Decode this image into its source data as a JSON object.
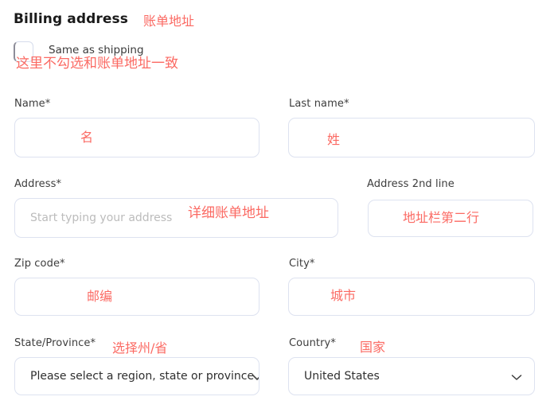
{
  "section": {
    "title": "Billing address",
    "title_annotation": "账单地址"
  },
  "checkbox": {
    "label": "Same as shipping",
    "checked": false,
    "annotation": "这里不勾选和账单地址一致"
  },
  "colors": {
    "annotation": "#fb6a63",
    "field_border": "#dde2f0",
    "placeholder": "#bcbcbc",
    "label": "#3d3d3d",
    "title": "#1a1a1a"
  },
  "fields": [
    {
      "name": "first-name",
      "label": "Name*",
      "value": "",
      "placeholder": "",
      "type": "text",
      "annotation": "名"
    },
    {
      "name": "last-name",
      "label": "Last name*",
      "value": "",
      "placeholder": "",
      "type": "text",
      "annotation": "姓"
    },
    {
      "name": "address",
      "label": "Address*",
      "value": "",
      "placeholder": "Start typing your address",
      "type": "text",
      "annotation": "详细账单地址"
    },
    {
      "name": "address-2nd-line",
      "label": "Address 2nd line",
      "value": "",
      "placeholder": "",
      "type": "text",
      "annotation": "地址栏第二行"
    },
    {
      "name": "zip-code",
      "label": "Zip code*",
      "value": "",
      "placeholder": "",
      "type": "text",
      "annotation": "邮编"
    },
    {
      "name": "city",
      "label": "City*",
      "value": "",
      "placeholder": "",
      "type": "text",
      "annotation": "城市"
    },
    {
      "name": "state-province",
      "label": "State/Province*",
      "value": "Please select a region, state or province",
      "placeholder": "",
      "type": "select",
      "annotation": "选择州/省"
    },
    {
      "name": "country",
      "label": "Country*",
      "value": "United States",
      "placeholder": "",
      "type": "select",
      "annotation": "国家"
    }
  ],
  "icons": {
    "chevron_down": "chevron-down-icon",
    "checkbox_empty": "checkbox-unchecked-icon"
  }
}
